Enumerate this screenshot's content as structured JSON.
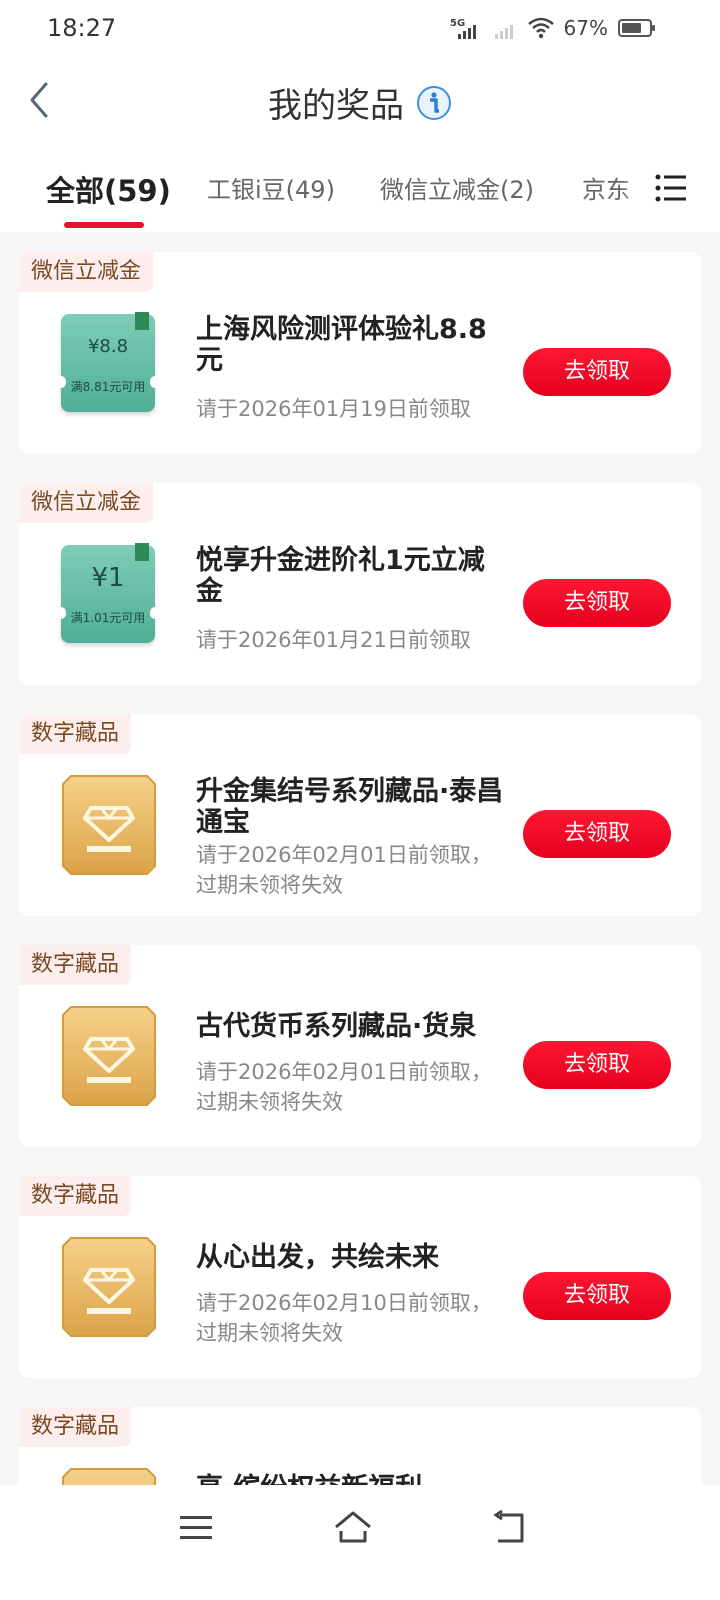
{
  "status": {
    "time": "18:27",
    "battery": "67%"
  },
  "header": {
    "title": "我的奖品"
  },
  "tabs": [
    {
      "label": "全部(59)"
    },
    {
      "label": "工银i豆(49)"
    },
    {
      "label": "微信立减金(2)"
    },
    {
      "label": "京东"
    }
  ],
  "claim_label": "去领取",
  "prizes": [
    {
      "tag": "微信立减金",
      "title": "上海风险测评体验礼8.8元",
      "expiry": "请于2026年01月19日前领取",
      "coupon_amount": "¥8.8",
      "coupon_condition": "满8.81元可用",
      "thumb": "wechat-coupon"
    },
    {
      "tag": "微信立减金",
      "title": "悦享升金进阶礼1元立减金",
      "expiry": "请于2026年01月21日前领取",
      "coupon_amount": "¥1",
      "coupon_condition": "满1.01元可用",
      "thumb": "wechat-coupon"
    },
    {
      "tag": "数字藏品",
      "title": "升金集结号系列藏品·泰昌通宝",
      "expiry": "请于2026年02月01日前领取，过期未领将失效",
      "thumb": "digital-collectible"
    },
    {
      "tag": "数字藏品",
      "title": "古代货币系列藏品·货泉",
      "expiry": "请于2026年02月01日前领取，过期未领将失效",
      "thumb": "digital-collectible"
    },
    {
      "tag": "数字藏品",
      "title": "从心出发，共绘未来",
      "expiry": "请于2026年02月10日前领取，过期未领将失效",
      "thumb": "digital-collectible"
    },
    {
      "tag": "数字藏品",
      "title": "享·缤纷权益新福利",
      "thumb": "digital-collectible"
    }
  ]
}
